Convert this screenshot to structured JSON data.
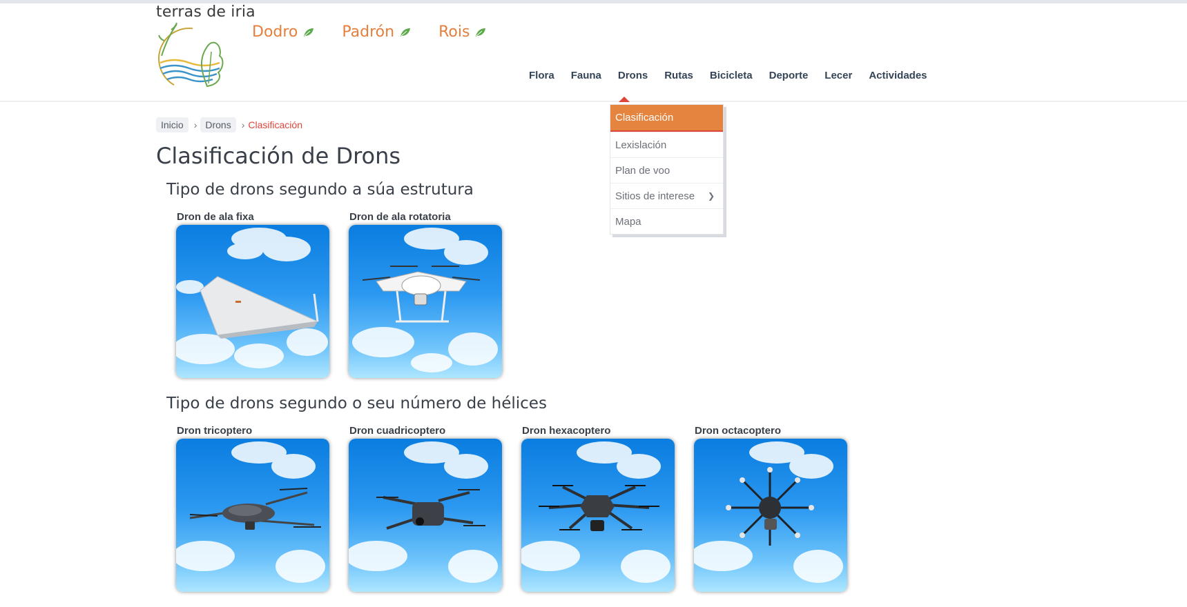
{
  "site": {
    "title": "terras de iria"
  },
  "municipalities": [
    {
      "label": "Dodro"
    },
    {
      "label": "Padrón"
    },
    {
      "label": "Rois"
    }
  ],
  "main_nav": [
    {
      "label": "Flora"
    },
    {
      "label": "Fauna"
    },
    {
      "label": "Drons"
    },
    {
      "label": "Rutas"
    },
    {
      "label": "Bicicleta"
    },
    {
      "label": "Deporte"
    },
    {
      "label": "Lecer"
    },
    {
      "label": "Actividades"
    }
  ],
  "dropdown": [
    {
      "label": "Clasificación",
      "active": true
    },
    {
      "label": "Lexislación"
    },
    {
      "label": "Plan de voo"
    },
    {
      "label": "Sitios de interese",
      "has_submenu": true
    },
    {
      "label": "Mapa"
    }
  ],
  "breadcrumb": [
    {
      "label": "Inicio"
    },
    {
      "label": "Drons"
    },
    {
      "label": "Clasificación"
    }
  ],
  "page": {
    "title": "Clasificación de Drons"
  },
  "sections": [
    {
      "title": "Tipo de drons segundo a súa estrutura",
      "cards": [
        {
          "label": "Dron de ala fixa",
          "icon": "fixed-wing-drone"
        },
        {
          "label": "Dron de ala rotatoria",
          "icon": "quadcopter-drone"
        }
      ]
    },
    {
      "title": "Tipo de drons segundo o seu número de hélices",
      "cards": [
        {
          "label": "Dron tricoptero",
          "icon": "tricopter-drone"
        },
        {
          "label": "Dron cuadricoptero",
          "icon": "quadcopter-drone"
        },
        {
          "label": "Dron hexacoptero",
          "icon": "hexacopter-drone"
        },
        {
          "label": "Dron octacoptero",
          "icon": "octocopter-drone"
        }
      ]
    }
  ],
  "colors": {
    "accent_orange": "#e5843f",
    "accent_red": "#e0453a",
    "nav_text": "#344456",
    "leaf_green": "#5daa4c"
  }
}
